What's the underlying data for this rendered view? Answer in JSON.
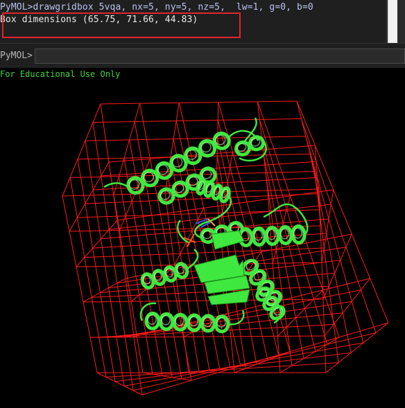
{
  "console": {
    "command_line": "PyMOL>drawgridbox 5vqa, nx=5, ny=5, nz=5,  lw=1, g=0, b=0",
    "output_line": "Box dimensions (65.75, 71.66, 44.83)"
  },
  "prompt": {
    "label": "PyMOL>",
    "value": ""
  },
  "viewport": {
    "watermark": "For Educational Use Only"
  },
  "colors": {
    "grid": "#ff1a1a",
    "cartoon": "#3fe83f",
    "highlight": "#e0262f",
    "watermark": "#3fd63f"
  }
}
